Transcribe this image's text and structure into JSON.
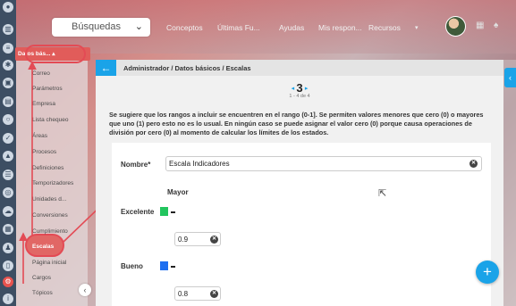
{
  "topbar": {
    "search_label": "Búsquedas",
    "nav": [
      "Conceptos",
      "Últimas Fu...",
      "Ayudas",
      "Mis respon...",
      "Recursos"
    ]
  },
  "sidebar": {
    "header": "Datos bás... ▴",
    "items": [
      "Correo",
      "Parámetros",
      "Empresa",
      "Lista chequeo",
      "Áreas",
      "Procesos",
      "Definiciones",
      "Temporizadores",
      "Unidades d...",
      "Conversiones",
      "Cumplimiento",
      "Escalas",
      "Página inicial",
      "Cargos",
      "Tópicos"
    ],
    "selected": "Escalas"
  },
  "main": {
    "breadcrumb": "Administrador / Datos básicos / Escalas",
    "pager": {
      "current": "3",
      "summary": "1 - 4 de 4"
    },
    "notice": "Se sugiere que los rangos a incluir se encuentren en el rango (0-1]. Se permiten valores menores que cero (0) o mayores que uno (1) pero esto no es lo usual. En ningún caso se puede asignar el valor cero (0) porque causa operaciones de división por cero (0) al momento de calcular los límites de los estados.",
    "form": {
      "name_label": "Nombre*",
      "name_value": "Escala Indicadores",
      "column_header": "Mayor",
      "rows": [
        {
          "label": "Excelente",
          "color": "#22c55e",
          "value": "0.9"
        },
        {
          "label": "Bueno",
          "color": "#1e6ff0",
          "value": "0.8"
        }
      ]
    }
  },
  "colors": {
    "accent": "#1aa3e8",
    "highlight": "#e34b55"
  }
}
